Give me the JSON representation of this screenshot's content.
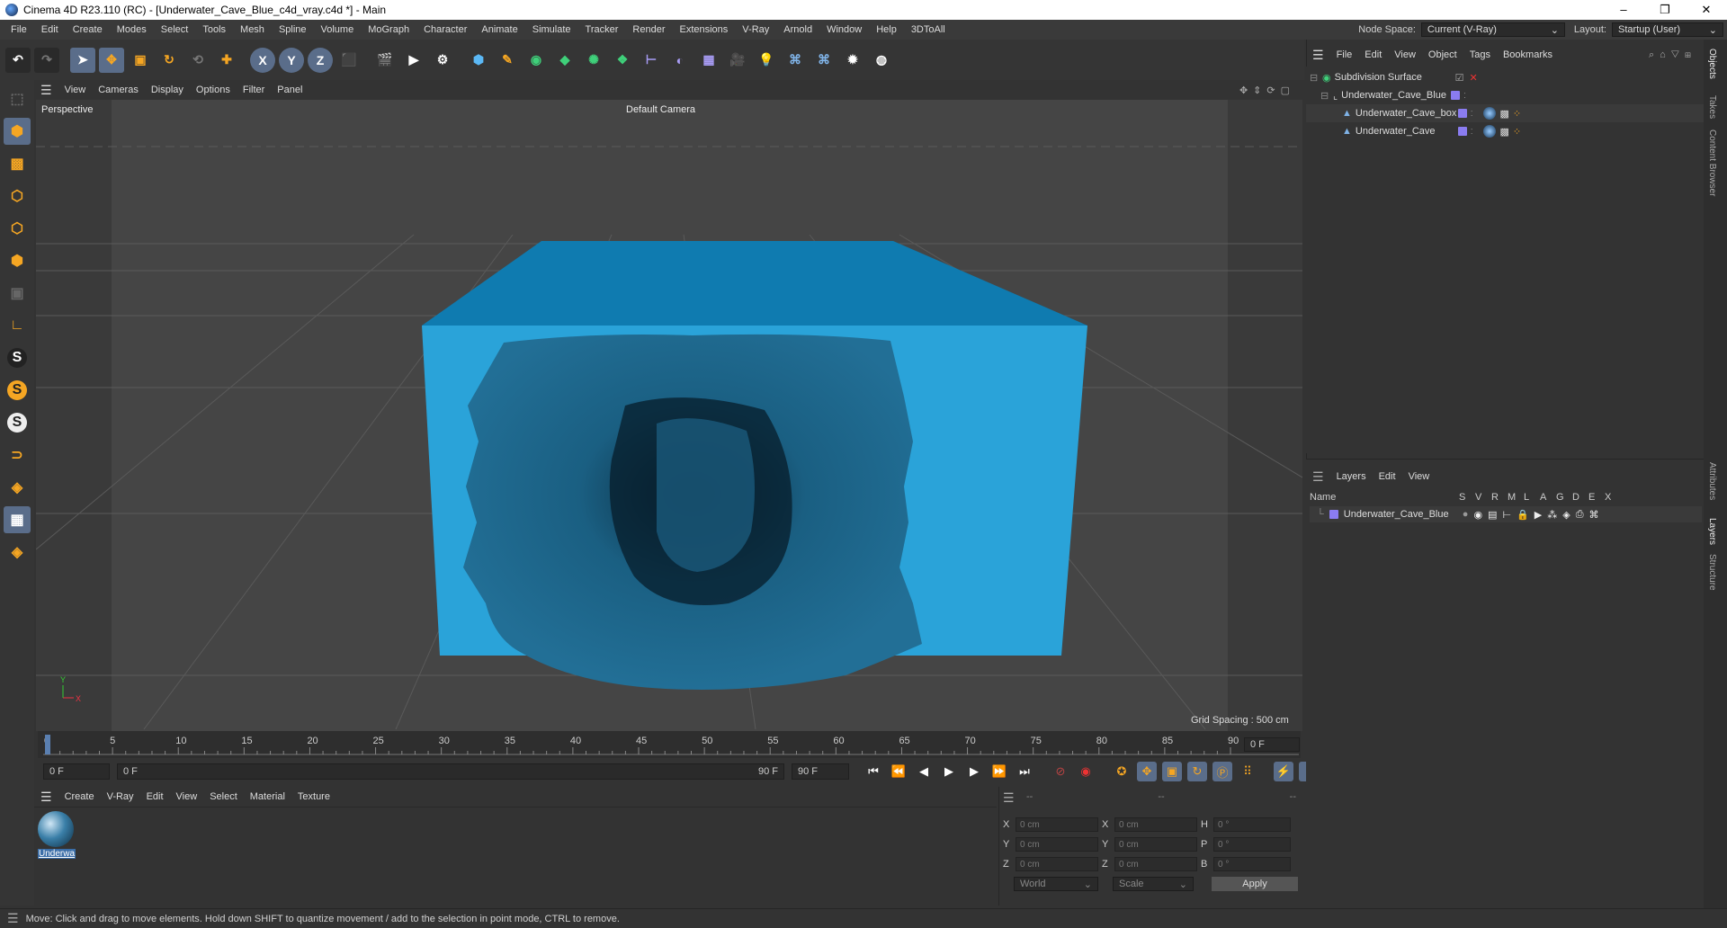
{
  "window": {
    "title": "Cinema 4D R23.110 (RC) - [Underwater_Cave_Blue_c4d_vray.c4d *] - Main",
    "minimize": "–",
    "maximize": "❐",
    "close": "✕"
  },
  "menubar": {
    "items": [
      "File",
      "Edit",
      "Create",
      "Modes",
      "Select",
      "Tools",
      "Mesh",
      "Spline",
      "Volume",
      "MoGraph",
      "Character",
      "Animate",
      "Simulate",
      "Tracker",
      "Render",
      "Extensions",
      "V-Ray",
      "Arnold",
      "Window",
      "Help",
      "3DToAll"
    ],
    "node_space_label": "Node Space:",
    "node_space_value": "Current (V-Ray)",
    "layout_label": "Layout:",
    "layout_value": "Startup (User)"
  },
  "toolbar": {
    "x_label": "X",
    "y_label": "Y",
    "z_label": "Z"
  },
  "lefttools": {
    "s1": "S",
    "s2": "S",
    "s3": "S"
  },
  "viewport": {
    "menu": [
      "View",
      "Cameras",
      "Display",
      "Options",
      "Filter",
      "Panel"
    ],
    "label": "Perspective",
    "camera": "Default Camera",
    "grid_spacing": "Grid Spacing : 500 cm",
    "axis_y": "Y",
    "axis_x": "X"
  },
  "timeline": {
    "ticks": [
      "0",
      "5",
      "10",
      "15",
      "20",
      "25",
      "30",
      "35",
      "40",
      "45",
      "50",
      "55",
      "60",
      "65",
      "70",
      "75",
      "80",
      "85",
      "90"
    ],
    "end_field": "0 F"
  },
  "transport": {
    "current": "0 F",
    "start": "0 F",
    "range_end": "90 F",
    "end": "90 F"
  },
  "material_manager": {
    "menu": [
      "Create",
      "V-Ray",
      "Edit",
      "View",
      "Select",
      "Material",
      "Texture"
    ],
    "material_name": "Underwa"
  },
  "coordinates": {
    "header": [
      "--",
      "--",
      "--"
    ],
    "rows": [
      {
        "l1": "X",
        "v1": "0 cm",
        "l2": "X",
        "v2": "0 cm",
        "l3": "H",
        "v3": "0 °"
      },
      {
        "l1": "Y",
        "v1": "0 cm",
        "l2": "Y",
        "v2": "0 cm",
        "l3": "P",
        "v3": "0 °"
      },
      {
        "l1": "Z",
        "v1": "0 cm",
        "l2": "Z",
        "v2": "0 cm",
        "l3": "B",
        "v3": "0 °"
      }
    ],
    "mode1": "World",
    "mode2": "Scale",
    "apply": "Apply"
  },
  "objects_panel": {
    "menu": [
      "File",
      "Edit",
      "View",
      "Object",
      "Tags",
      "Bookmarks"
    ],
    "items": [
      {
        "name": "Subdivision Surface"
      },
      {
        "name": "Underwater_Cave_Blue"
      },
      {
        "name": "Underwater_Cave_box"
      },
      {
        "name": "Underwater_Cave"
      }
    ]
  },
  "layers_panel": {
    "menu": [
      "Layers",
      "Edit",
      "View"
    ],
    "columns": [
      "Name",
      "S",
      "V",
      "R",
      "M",
      "L",
      "A",
      "G",
      "D",
      "E",
      "X"
    ],
    "layers": [
      {
        "name": "Underwater_Cave_Blue"
      }
    ]
  },
  "side_tabs": [
    "Objects",
    "Takes",
    "Content Browser",
    "Attributes",
    "Layers",
    "Structure"
  ],
  "status": "Move: Click and drag to move elements. Hold down SHIFT to quantize movement / add to the selection in point mode, CTRL to remove.",
  "colors": {
    "accent": "#2aa3d9",
    "cave": "#1d6a90",
    "layer": "#8a7cf0"
  }
}
